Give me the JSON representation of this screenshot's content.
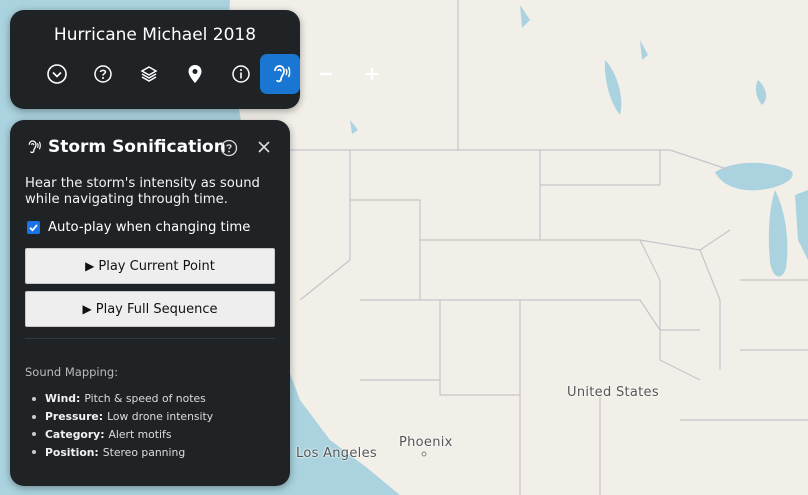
{
  "toolbar": {
    "title": "Hurricane Michael 2018",
    "buttons": [
      {
        "icon": "chevron-down-circle-icon"
      },
      {
        "icon": "help-circle-icon"
      },
      {
        "icon": "layers-icon"
      },
      {
        "icon": "location-pin-icon"
      },
      {
        "icon": "info-icon"
      },
      {
        "icon": "hearing-icon",
        "active": true
      },
      {
        "icon": "zoom-out-icon"
      },
      {
        "icon": "zoom-in-icon"
      }
    ]
  },
  "panel": {
    "title": "Storm Sonification",
    "description": "Hear the storm's intensity as sound while navigating through time.",
    "autoplay_label": "Auto-play when changing time",
    "autoplay_checked": true,
    "play_current_label": "Play Current Point",
    "play_sequence_label": "Play Full Sequence",
    "mapping_title": "Sound Mapping:",
    "mappings": [
      {
        "key": "Wind:",
        "value": "Pitch & speed of notes"
      },
      {
        "key": "Pressure:",
        "value": "Low drone intensity"
      },
      {
        "key": "Category:",
        "value": "Alert motifs"
      },
      {
        "key": "Position:",
        "value": "Stereo panning"
      }
    ]
  },
  "map": {
    "labels": {
      "us": "United States",
      "la": "Los Angeles",
      "phoenix": "Phoenix"
    },
    "colors": {
      "land": "#f2efe9",
      "water": "#aad3df",
      "border": "#c9c3cc"
    }
  }
}
